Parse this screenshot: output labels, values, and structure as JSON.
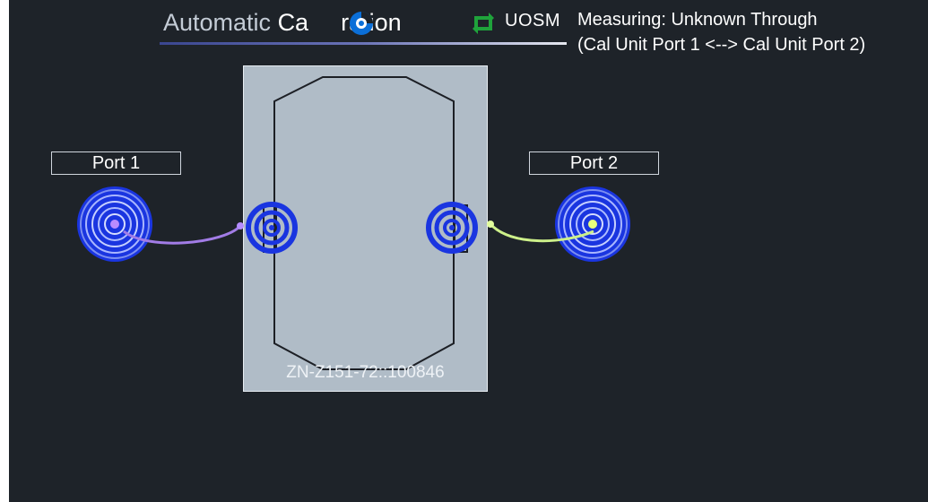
{
  "header": {
    "title_prefix": "Automatic ",
    "title_bold": "Ca",
    "title_rest": "ration",
    "mode": "UOSM",
    "measuring_line1": "Measuring: Unknown Through",
    "measuring_line2": "(Cal Unit Port 1 <--> Cal Unit Port 2)"
  },
  "ports": {
    "port1_label": "Port 1",
    "port2_label": "Port 2"
  },
  "cal_unit": {
    "serial": "ZN-Z151-72::100846"
  },
  "colors": {
    "background": "#1e2329",
    "cal_unit": "#b0bcc7",
    "coil_blue": "#1a35e0",
    "cable_port1": "#a27ce6",
    "cable_port2": "#cdf08a",
    "sync_icon": "#1fa33b"
  },
  "icons": {
    "spinner": "busy-spinner",
    "sync": "sync-arrows",
    "port1": "coil",
    "port2": "coil"
  }
}
